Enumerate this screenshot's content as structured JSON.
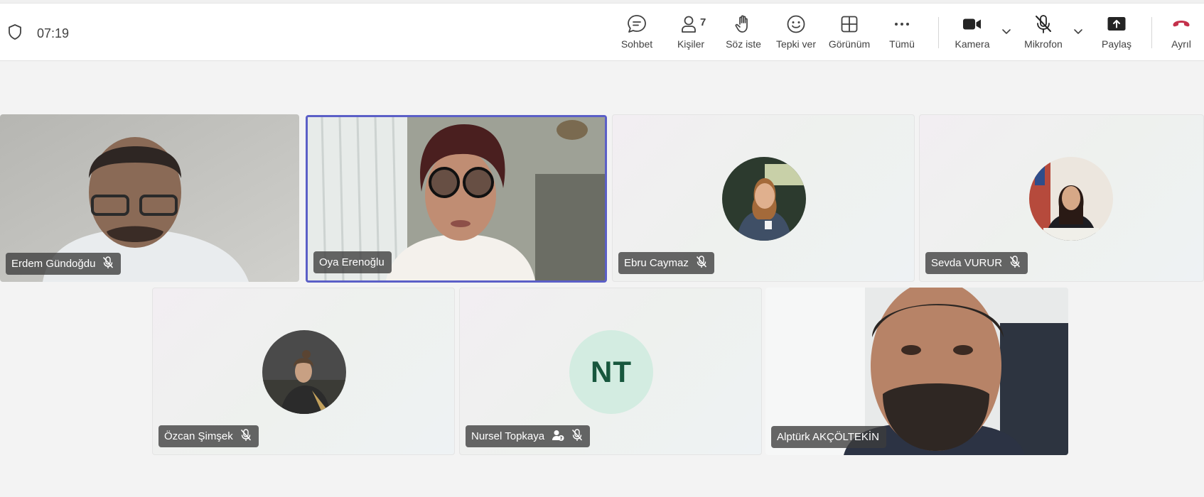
{
  "call": {
    "timer": "07:19"
  },
  "toolbar": {
    "chat": "Sohbet",
    "people": "Kişiler",
    "people_count": "7",
    "raise_hand": "Söz iste",
    "react": "Tepki ver",
    "view": "Görünüm",
    "more": "Tümü",
    "camera": "Kamera",
    "mic": "Mikrofon",
    "share": "Paylaş",
    "leave": "Ayrıl"
  },
  "participants": [
    {
      "name": "Erdem Gündoğdu",
      "muted": true,
      "video": true
    },
    {
      "name": "Oya Erenoğlu",
      "muted": false,
      "video": true,
      "speaking": true
    },
    {
      "name": "Ebru Caymaz",
      "muted": true,
      "video": false
    },
    {
      "name": "Sevda VURUR",
      "muted": true,
      "video": false
    },
    {
      "name": "Özcan Şimşek",
      "muted": true,
      "video": false
    },
    {
      "name": "Nursel Topkaya",
      "muted": true,
      "video": false,
      "initials": "NT",
      "unverified_icon": "guest-icon"
    },
    {
      "name": "Alptürk AKÇÖLTEKİN",
      "muted": false,
      "video": true
    }
  ],
  "colors": {
    "accent": "#5b5fc7",
    "leave": "#c4314b",
    "initials_bg": "#d3ece1",
    "initials_fg": "#17573d"
  }
}
